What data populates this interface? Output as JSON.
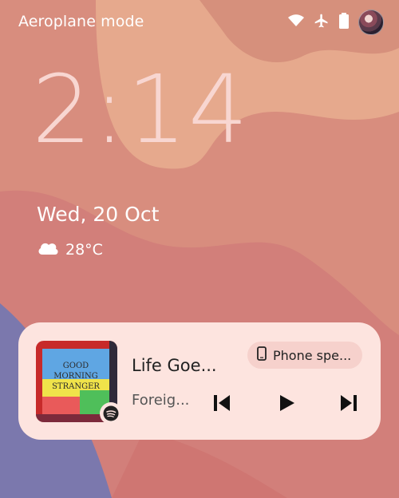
{
  "status_bar": {
    "mode_text": "Aeroplane mode",
    "icons": [
      "wifi-icon",
      "airplane-icon",
      "battery-icon",
      "avatar"
    ]
  },
  "lockscreen": {
    "time": "2:14",
    "date": "Wed, 20 Oct",
    "weather": {
      "icon": "cloud-icon",
      "temperature": "28°C"
    }
  },
  "media": {
    "album_art": {
      "lines": [
        "GOOD",
        "MORNING",
        "STRANGER"
      ]
    },
    "title": "Life Goe...",
    "artist": "Foreig...",
    "output_device": "Phone spe...",
    "controls": [
      "previous-icon",
      "play-icon",
      "next-icon"
    ],
    "app_icon": "spotify-icon"
  },
  "colors": {
    "card": "#fde4df",
    "chip": "#f6d1cc",
    "clock": "#f8d6d1"
  }
}
